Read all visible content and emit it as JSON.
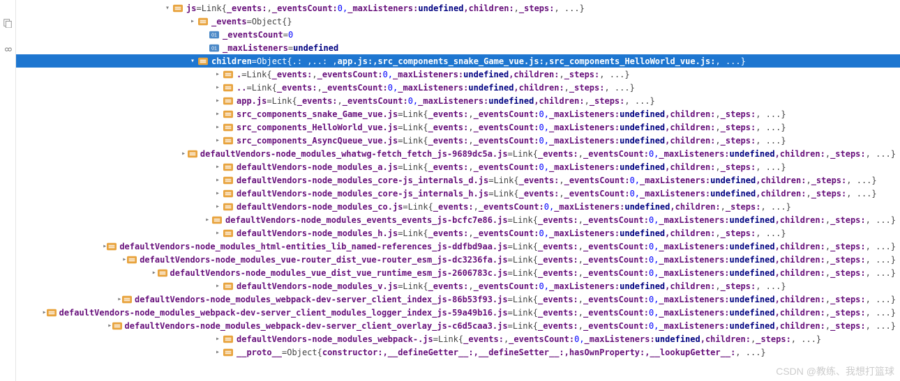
{
  "watermark": "CSDN @教练、我想打篮球",
  "icons": {
    "copy": "copy-icon",
    "inf": "infinity-icon"
  },
  "linkSig": {
    "pre": "{",
    "post": ", ...}",
    "p1": "_events:",
    "v1": " ,",
    "p2": "_eventsCount:",
    "v2": " 0,",
    "p3": "_maxListeners:",
    "v3": " undefined",
    "p4": ",children:",
    "v4": " ,",
    "p5": "_steps:"
  },
  "childrenSig": {
    "pre": "{.: ,..: ,",
    "a": "app.js:",
    "b": " ,src_components_snake_Game_vue.js:",
    "c": " ,src_components_HelloWorld_vue.js:",
    "post": " , ...}"
  },
  "objEmpty": "{}",
  "eq": " = ",
  "linkLabel": "Link ",
  "objLabel": "Object ",
  "rows": [
    {
      "indent": 210,
      "arrow": "down",
      "ico": "obj",
      "name": "js",
      "isLink": true
    },
    {
      "indent": 246,
      "arrow": "right",
      "ico": "obj",
      "name": "_events",
      "objEmpty": true
    },
    {
      "indent": 262,
      "arrow": "",
      "ico": "num",
      "name": "_eventsCount",
      "raw": "0",
      "rawCls": "num"
    },
    {
      "indent": 262,
      "arrow": "",
      "ico": "num",
      "name": "_maxListeners",
      "raw": "undefined",
      "rawCls": "und"
    },
    {
      "indent": 246,
      "arrow": "down",
      "ico": "obj",
      "name": "children",
      "childrenSig": true,
      "selected": true
    },
    {
      "indent": 282,
      "arrow": "right",
      "ico": "obj",
      "name": ".",
      "isLink": true
    },
    {
      "indent": 282,
      "arrow": "right",
      "ico": "obj",
      "name": "..",
      "isLink": true
    },
    {
      "indent": 282,
      "arrow": "right",
      "ico": "obj",
      "name": "app.js",
      "isLink": true
    },
    {
      "indent": 282,
      "arrow": "right",
      "ico": "obj",
      "name": "src_components_snake_Game_vue.js",
      "isLink": true
    },
    {
      "indent": 282,
      "arrow": "right",
      "ico": "obj",
      "name": "src_components_HelloWorld_vue.js",
      "isLink": true
    },
    {
      "indent": 282,
      "arrow": "right",
      "ico": "obj",
      "name": "src_components_AsyncQueue_vue.js",
      "isLink": true
    },
    {
      "indent": 282,
      "arrow": "right",
      "ico": "obj",
      "name": "defaultVendors-node_modules_whatwg-fetch_fetch_js-9689dc5a.js",
      "isLink": true
    },
    {
      "indent": 282,
      "arrow": "right",
      "ico": "obj",
      "name": "defaultVendors-node_modules_a.js",
      "isLink": true
    },
    {
      "indent": 282,
      "arrow": "right",
      "ico": "obj",
      "name": "defaultVendors-node_modules_core-js_internals_d.js",
      "isLink": true
    },
    {
      "indent": 282,
      "arrow": "right",
      "ico": "obj",
      "name": "defaultVendors-node_modules_core-js_internals_h.js",
      "isLink": true
    },
    {
      "indent": 282,
      "arrow": "right",
      "ico": "obj",
      "name": "defaultVendors-node_modules_co.js",
      "isLink": true
    },
    {
      "indent": 282,
      "arrow": "right",
      "ico": "obj",
      "name": "defaultVendors-node_modules_events_events_js-bcfc7e86.js",
      "isLink": true
    },
    {
      "indent": 282,
      "arrow": "right",
      "ico": "obj",
      "name": "defaultVendors-node_modules_h.js",
      "isLink": true
    },
    {
      "indent": 282,
      "arrow": "right",
      "ico": "obj",
      "name": "defaultVendors-node_modules_html-entities_lib_named-references_js-ddfbd9aa.js",
      "isLink": true
    },
    {
      "indent": 282,
      "arrow": "right",
      "ico": "obj",
      "name": "defaultVendors-node_modules_vue-router_dist_vue-router_esm_js-dc3236fa.js",
      "isLink": true
    },
    {
      "indent": 282,
      "arrow": "right",
      "ico": "obj",
      "name": "defaultVendors-node_modules_vue_dist_vue_runtime_esm_js-2606783c.js",
      "isLink": true
    },
    {
      "indent": 282,
      "arrow": "right",
      "ico": "obj",
      "name": "defaultVendors-node_modules_v.js",
      "isLink": true
    },
    {
      "indent": 282,
      "arrow": "right",
      "ico": "obj",
      "name": "defaultVendors-node_modules_webpack-dev-server_client_index_js-86b53f93.js",
      "isLink": true
    },
    {
      "indent": 282,
      "arrow": "right",
      "ico": "obj",
      "name": "defaultVendors-node_modules_webpack-dev-server_client_modules_logger_index_js-59a49b16.js",
      "isLink": true
    },
    {
      "indent": 282,
      "arrow": "right",
      "ico": "obj",
      "name": "defaultVendors-node_modules_webpack-dev-server_client_overlay_js-c6d5caa3.js",
      "isLink": true
    },
    {
      "indent": 282,
      "arrow": "right",
      "ico": "obj",
      "name": "defaultVendors-node_modules_webpack-.js",
      "isLink": true
    },
    {
      "indent": 282,
      "arrow": "right",
      "ico": "obj",
      "name": "__proto__",
      "proto": true
    }
  ],
  "protoSig": {
    "pre": "{",
    "a": "constructor:",
    "b": " ,__defineGetter__:",
    "c": " ,__defineSetter__:",
    "d": " ,hasOwnProperty:",
    "e": " ,__lookupGetter__:",
    "post": " , ...}"
  }
}
